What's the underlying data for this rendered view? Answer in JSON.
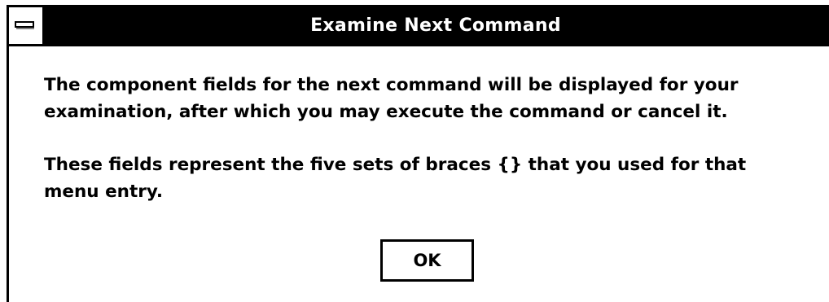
{
  "window": {
    "title": "Examine Next Command"
  },
  "message": {
    "paragraph1_line1": "The component fields for the next command will be displayed for your",
    "paragraph1_line2": "examination, after which you may execute the command or cancel it.",
    "paragraph2_line1": "These fields represent the five sets of braces  {}  that you used for that",
    "paragraph2_line2": "menu entry."
  },
  "buttons": {
    "ok_label": "OK"
  },
  "icons": {
    "system_menu": "system-menu-icon"
  },
  "colors": {
    "title_bar_bg": "#000000",
    "title_text": "#ffffff",
    "window_bg": "#ffffff",
    "text": "#000000"
  }
}
